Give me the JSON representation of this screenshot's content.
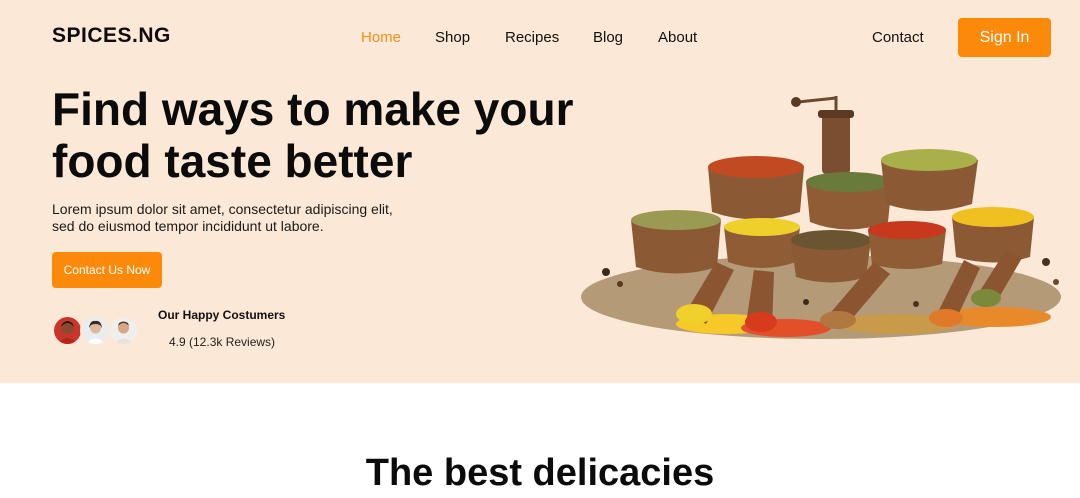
{
  "brand": {
    "name": "SPICES.NG"
  },
  "nav": {
    "items": [
      {
        "label": "Home",
        "active": true
      },
      {
        "label": "Shop",
        "active": false
      },
      {
        "label": "Recipes",
        "active": false
      },
      {
        "label": "Blog",
        "active": false
      },
      {
        "label": "About",
        "active": false
      }
    ],
    "contact_label": "Contact",
    "signin_label": "Sign In"
  },
  "hero": {
    "headline": "Find ways to make your food taste better",
    "subtext": "Lorem ipsum dolor sit amet, consectetur adipiscing elit, sed do eiusmod tempor incididunt ut labore.",
    "cta_label": "Contact Us Now",
    "reviews_title": "Our Happy Costumers",
    "reviews_rating": "4.9 (12.3k Reviews)",
    "image_icon": "spice-bowls-illustration"
  },
  "section": {
    "title": "The best delicacies"
  },
  "colors": {
    "accent": "#fb8a0a",
    "hero_bg": "#fbe8d6",
    "active_nav": "#f39019",
    "text": "#111111"
  }
}
